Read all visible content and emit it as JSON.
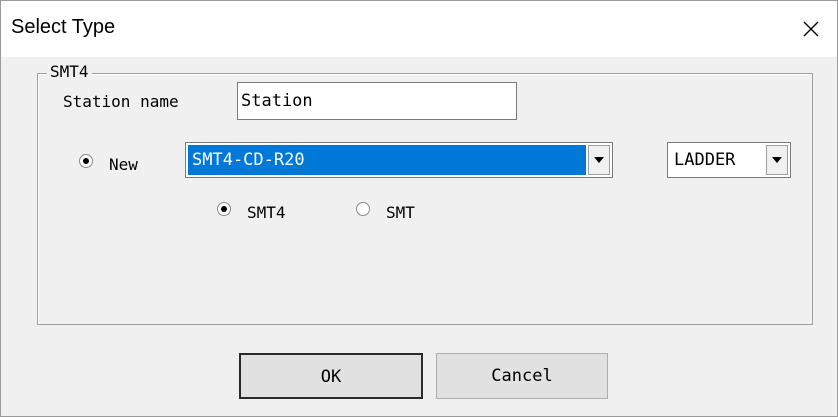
{
  "window": {
    "title": "Select Type"
  },
  "group": {
    "label": "SMT4"
  },
  "station": {
    "label": "Station name",
    "value": "Station"
  },
  "mode": {
    "new_label": "New",
    "new_checked": true
  },
  "model_select": {
    "selected": "SMT4-CD-R20"
  },
  "language_select": {
    "selected": "LADDER"
  },
  "type": {
    "options": [
      {
        "label": "SMT4",
        "checked": true
      },
      {
        "label": "SMT",
        "checked": false
      }
    ]
  },
  "buttons": {
    "ok": "OK",
    "cancel": "Cancel"
  },
  "colors": {
    "selection": "#0078d7",
    "dialog_bg": "#f0f0f0"
  },
  "icons": {
    "close": "close-icon",
    "dropdown": "chevron-down-icon"
  }
}
